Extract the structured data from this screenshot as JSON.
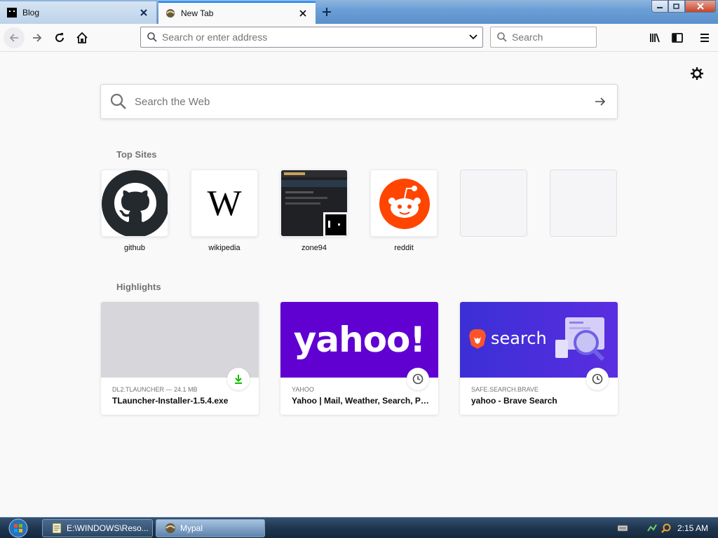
{
  "tabs": [
    {
      "title": "Blog",
      "active": false
    },
    {
      "title": "New Tab",
      "active": true
    }
  ],
  "toolbar": {
    "url_placeholder": "Search or enter address",
    "search_placeholder": "Search"
  },
  "newtab": {
    "websearch_placeholder": "Search the Web",
    "top_sites_title": "Top Sites",
    "highlights_title": "Highlights",
    "top_sites": [
      {
        "label": "github"
      },
      {
        "label": "wikipedia",
        "glyph": "W"
      },
      {
        "label": "zone94"
      },
      {
        "label": "reddit"
      },
      {
        "label": ""
      },
      {
        "label": ""
      }
    ],
    "highlights": [
      {
        "source": "DL2.TLAUNCHER — 24.1 MB",
        "title": "TLauncher-Installer-1.5.4.exe",
        "badge": "download-icon"
      },
      {
        "source": "YAHOO",
        "title": "Yahoo | Mail, Weather, Search, Politics, News, Finance, Sports & Videos",
        "thumb_text": "yahoo!",
        "badge": "clock-icon"
      },
      {
        "source": "SAFE.SEARCH.BRAVE",
        "title": "yahoo - Brave Search",
        "thumb_text": "search",
        "badge": "clock-icon"
      }
    ]
  },
  "taskbar": {
    "items": [
      {
        "label": "E:\\WINDOWS\\Reso..."
      },
      {
        "label": "Mypal"
      }
    ],
    "clock": "2:15 AM"
  },
  "colors": {
    "accent": "#0a84ff",
    "yahoo_purple": "#6001d2",
    "brave_purple": "#3b2fd6",
    "reddit_orange": "#ff4500",
    "download_green": "#12bc00"
  }
}
